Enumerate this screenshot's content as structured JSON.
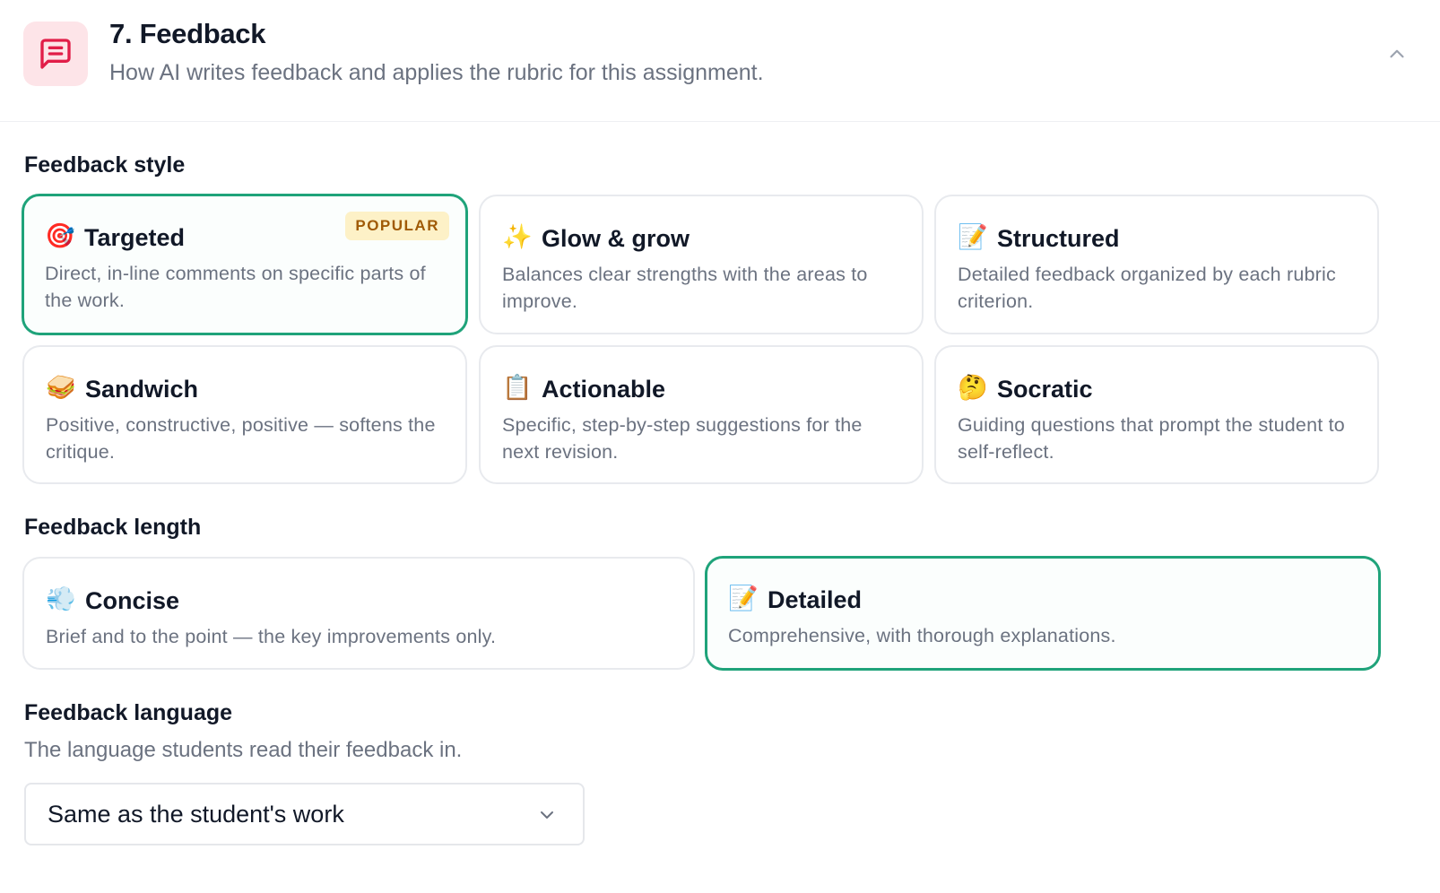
{
  "header": {
    "title": "7. Feedback",
    "subtitle": "How AI writes feedback and applies the rubric for this assignment.",
    "icon": "message-square-text-icon",
    "icon_color": "#e11d48",
    "icon_bg": "#fde4e8"
  },
  "feedback_style": {
    "label": "Feedback style",
    "selected": "Targeted",
    "options": [
      {
        "emoji": "🎯",
        "title": "Targeted",
        "desc": "Direct, in-line comments on specific parts of the work.",
        "badge": "POPULAR",
        "selected": true
      },
      {
        "emoji": "✨",
        "title": "Glow & grow",
        "desc": "Balances clear strengths with the areas to improve.",
        "selected": false
      },
      {
        "emoji": "📝",
        "title": "Structured",
        "desc": "Detailed feedback organized by each rubric criterion.",
        "selected": false
      },
      {
        "emoji": "🥪",
        "title": "Sandwich",
        "desc": "Positive, constructive, positive — softens the critique.",
        "selected": false
      },
      {
        "emoji": "📋",
        "title": "Actionable",
        "desc": "Specific, step-by-step suggestions for the next revision.",
        "selected": false
      },
      {
        "emoji": "🤔",
        "title": "Socratic",
        "desc": "Guiding questions that prompt the student to self-reflect.",
        "selected": false
      }
    ]
  },
  "feedback_length": {
    "label": "Feedback length",
    "selected": "Detailed",
    "options": [
      {
        "emoji": "💨",
        "title": "Concise",
        "desc": "Brief and to the point — the key improvements only.",
        "selected": false
      },
      {
        "emoji": "📝",
        "title": "Detailed",
        "desc": "Comprehensive, with thorough explanations.",
        "selected": true
      }
    ]
  },
  "feedback_language": {
    "label": "Feedback language",
    "subtitle": "The language students read their feedback in.",
    "value": "Same as the student's work"
  },
  "colors": {
    "accent": "#1fa37a",
    "badge_bg": "#fdf1c7",
    "badge_text": "#a05a06"
  }
}
